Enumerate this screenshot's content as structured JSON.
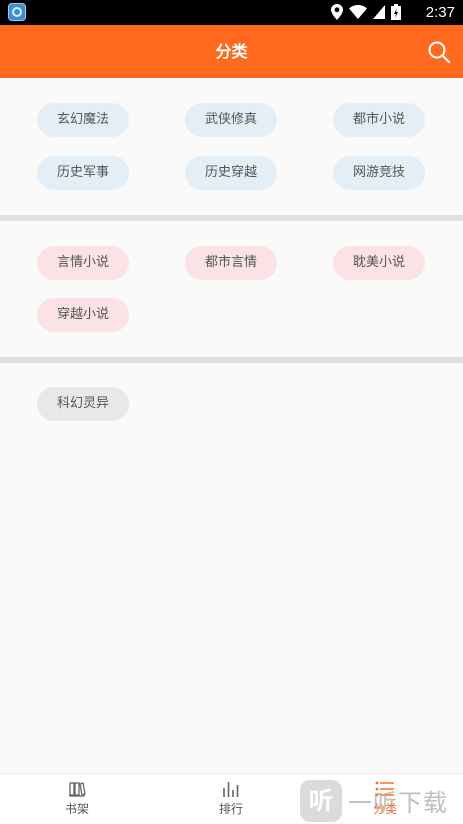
{
  "status_bar": {
    "time": "2:37"
  },
  "app_bar": {
    "title": "分类"
  },
  "sections": [
    {
      "name": "male",
      "items": [
        "玄幻魔法",
        "武侠修真",
        "都市小说",
        "历史军事",
        "历史穿越",
        "网游竞技"
      ]
    },
    {
      "name": "female",
      "items": [
        "言情小说",
        "都市言情",
        "耽美小说",
        "穿越小说"
      ]
    },
    {
      "name": "other",
      "items": [
        "科幻灵异"
      ]
    }
  ],
  "tabs": [
    {
      "label": "书架",
      "icon": "bookshelf-icon"
    },
    {
      "label": "排行",
      "icon": "ranking-icon"
    },
    {
      "label": "分类",
      "icon": "category-icon",
      "active": true
    }
  ],
  "watermark": {
    "logo": "听",
    "text": "一听下载"
  },
  "colors": {
    "accent": "#ff6a1f",
    "chip_blue": "#e3eef6",
    "chip_pink": "#fbe3e5",
    "chip_gray": "#e8e8e8"
  }
}
